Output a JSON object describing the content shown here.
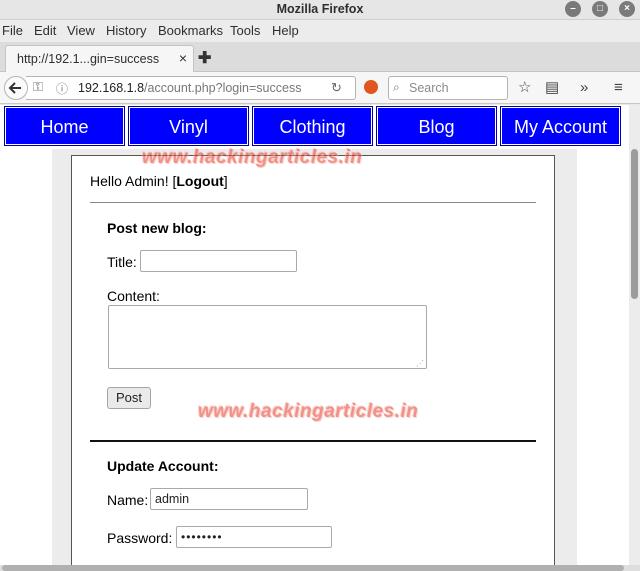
{
  "window": {
    "title": "Mozilla Firefox"
  },
  "menu": [
    "File",
    "Edit",
    "View",
    "History",
    "Bookmarks",
    "Tools",
    "Help"
  ],
  "tab": {
    "label": "http://192.1...gin=success"
  },
  "address": {
    "host": "192.168.1.8",
    "path": "/account.php?login=success"
  },
  "search": {
    "placeholder": "Search"
  },
  "site_nav": [
    "Home",
    "Vinyl",
    "Clothing",
    "Blog",
    "My Account"
  ],
  "greeting": {
    "prefix": "Hello Admin! [",
    "logout": "Logout",
    "suffix": "]"
  },
  "blog_form": {
    "heading": "Post new blog:",
    "title_label": "Title:",
    "title_value": "",
    "content_label": "Content:",
    "content_value": "",
    "post_button": "Post"
  },
  "account_form": {
    "heading": "Update Account:",
    "name_label": "Name:",
    "name_value": "admin",
    "password_label": "Password:",
    "password_value": "••••••••"
  },
  "watermark": "www.hackingarticles.in",
  "colors": {
    "nav_bg": "#0000ff",
    "nav_text": "#ffffff",
    "watermark": "#e63a2a"
  }
}
